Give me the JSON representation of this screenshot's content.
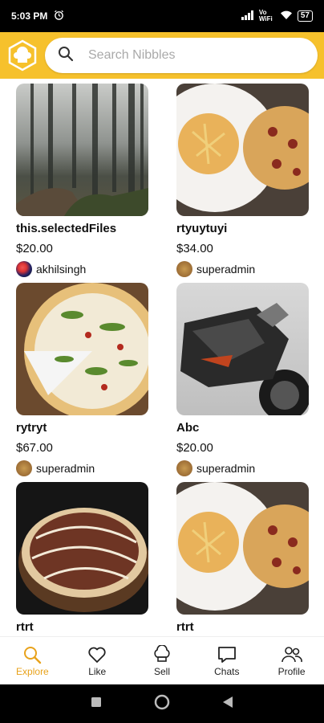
{
  "status_bar": {
    "time": "5:03 PM",
    "network": "Vo WiFi",
    "battery": "57"
  },
  "search": {
    "placeholder": "Search Nibbles"
  },
  "items": [
    {
      "title": "this.selectedFiles",
      "price": "$20.00",
      "user": "akhilsingh",
      "image": "forest-photo"
    },
    {
      "title": "rtyuytuyi",
      "price": "$34.00",
      "user": "superadmin",
      "image": "pasta-pizza-photo"
    },
    {
      "title": "rytryt",
      "price": "$67.00",
      "user": "superadmin",
      "image": "arugula-pizza-photo"
    },
    {
      "title": "Abc",
      "price": "$20.00",
      "user": "superadmin",
      "image": "motorcycle-photo"
    },
    {
      "title": "rtrt",
      "price": "",
      "user": "",
      "image": "pizza-photo"
    },
    {
      "title": "rtrt",
      "price": "",
      "user": "",
      "image": "pasta-pizza-photo"
    }
  ],
  "nav": [
    {
      "label": "Explore",
      "icon": "search-icon",
      "active": true
    },
    {
      "label": "Like",
      "icon": "heart-icon"
    },
    {
      "label": "Sell",
      "icon": "chef-hat-icon"
    },
    {
      "label": "Chats",
      "icon": "chat-icon"
    },
    {
      "label": "Profile",
      "icon": "people-icon"
    }
  ],
  "colors": {
    "header": "#f6c12c",
    "active_nav": "#e8a21b"
  }
}
